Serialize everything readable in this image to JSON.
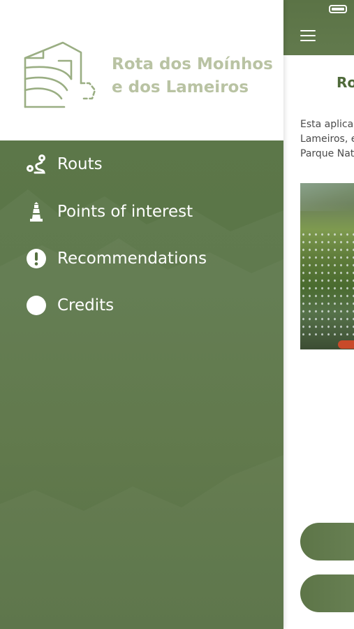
{
  "app": {
    "brand_line1": "Rota dos Moínhos",
    "brand_line2": "e dos Lameiros"
  },
  "drawer": {
    "menu": [
      {
        "label": "Routs",
        "icon": "route-icon"
      },
      {
        "label": "Points of interest",
        "icon": "lighthouse-icon"
      },
      {
        "label": "Recommendations",
        "icon": "alert-circle-icon"
      },
      {
        "label": "Credits",
        "icon": "circle-icon"
      }
    ]
  },
  "main": {
    "title": "Ro",
    "text_lines": [
      "Esta aplica",
      "Lameiros, e",
      "Parque Nat"
    ]
  },
  "colors": {
    "accent": "#5b7346",
    "brand_text": "#b9c3a3",
    "title_green": "#4f6a3a"
  }
}
